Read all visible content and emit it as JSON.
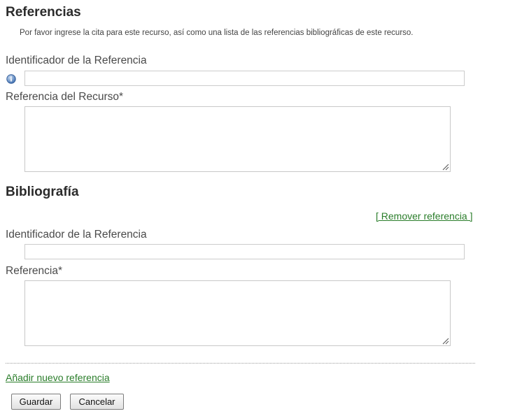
{
  "references_section": {
    "title": "Referencias",
    "intro": "Por favor ingrese la cita para este recurso, así como una lista de las referencias bibliográficas de este recurso.",
    "identifier_label": "Identificador de la Referencia",
    "identifier_value": "",
    "info_icon": "info-icon",
    "resource_reference_label": "Referencia del Recurso*",
    "resource_reference_value": ""
  },
  "bibliography_section": {
    "title": "Bibliografía",
    "remove_link": "[ Remover referencia ]",
    "identifier_label": "Identificador de la Referencia",
    "identifier_value": "",
    "reference_label": "Referencia*",
    "reference_value": ""
  },
  "add_link": "Añadir nuevo referencia",
  "buttons": {
    "save": "Guardar",
    "cancel": "Cancelar"
  },
  "colors": {
    "link": "#2a7d2a",
    "info_icon": "#3f6fb0",
    "heading": "#2b2b2b"
  }
}
